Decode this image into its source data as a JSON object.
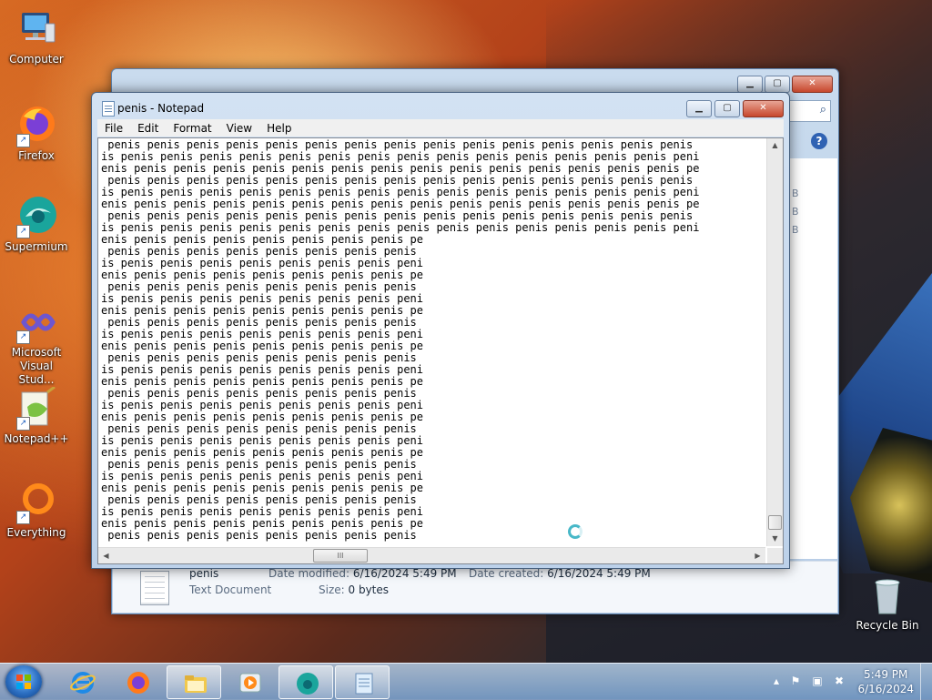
{
  "desktop": {
    "icons": [
      {
        "label": "Computer"
      },
      {
        "label": "Firefox"
      },
      {
        "label": "Supermium"
      },
      {
        "label": "Microsoft Visual Stud..."
      },
      {
        "label": "Notepad++"
      },
      {
        "label": "Everything"
      },
      {
        "label": "Recycle Bin"
      }
    ]
  },
  "explorer": {
    "details": {
      "file_name": "penis",
      "file_type": "Text Document",
      "date_modified_label": "Date modified:",
      "date_modified": "6/16/2024 5:49 PM",
      "date_created_label": "Date created:",
      "date_created": "6/16/2024 5:49 PM",
      "size_label": "Size:",
      "size": "0 bytes"
    },
    "side_letters": [
      "B",
      "B",
      "B"
    ]
  },
  "notepad": {
    "title": "penis - Notepad",
    "menu": [
      "File",
      "Edit",
      "Format",
      "View",
      "Help"
    ],
    "text_lines": [
      " penis penis penis penis penis penis penis penis penis penis penis penis penis penis penis",
      "is penis penis penis penis penis penis penis penis penis penis penis penis penis penis peni",
      "enis penis penis penis penis penis penis penis penis penis penis penis penis penis penis pe",
      " penis penis penis penis penis penis penis penis penis penis penis penis penis penis penis",
      "is penis penis penis penis penis penis penis penis penis penis penis penis penis penis peni",
      "enis penis penis penis penis penis penis penis penis penis penis penis penis penis penis pe",
      " penis penis penis penis penis penis penis penis penis penis penis penis penis penis penis",
      "is penis penis penis penis penis penis penis penis penis penis penis penis penis penis peni",
      "enis penis penis penis penis penis penis penis pe",
      " penis penis penis penis penis penis penis penis",
      "is penis penis penis penis penis penis penis peni",
      "enis penis penis penis penis penis penis penis pe",
      " penis penis penis penis penis penis penis penis",
      "is penis penis penis penis penis penis penis peni",
      "enis penis penis penis penis penis penis penis pe",
      " penis penis penis penis penis penis penis penis",
      "is penis penis penis penis penis penis penis peni",
      "enis penis penis penis penis penis penis penis pe",
      " penis penis penis penis penis penis penis penis",
      "is penis penis penis penis penis penis penis peni",
      "enis penis penis penis penis penis penis penis pe",
      " penis penis penis penis penis penis penis penis",
      "is penis penis penis penis penis penis penis peni",
      "enis penis penis penis penis penis penis penis pe",
      " penis penis penis penis penis penis penis penis",
      "is penis penis penis penis penis penis penis peni",
      "enis penis penis penis penis penis penis penis pe",
      " penis penis penis penis penis penis penis penis",
      "is penis penis penis penis penis penis penis peni",
      "enis penis penis penis penis penis penis penis pe",
      " penis penis penis penis penis penis penis penis",
      "is penis penis penis penis penis penis penis peni",
      "enis penis penis penis penis penis penis penis pe",
      " penis penis penis penis penis penis penis penis"
    ],
    "hscroll_grip": "III"
  },
  "taskbar": {
    "items": [
      "internet-explorer",
      "firefox",
      "file-explorer",
      "media-player",
      "supermium",
      "notepad"
    ],
    "time": "5:49 PM",
    "date": "6/16/2024"
  }
}
